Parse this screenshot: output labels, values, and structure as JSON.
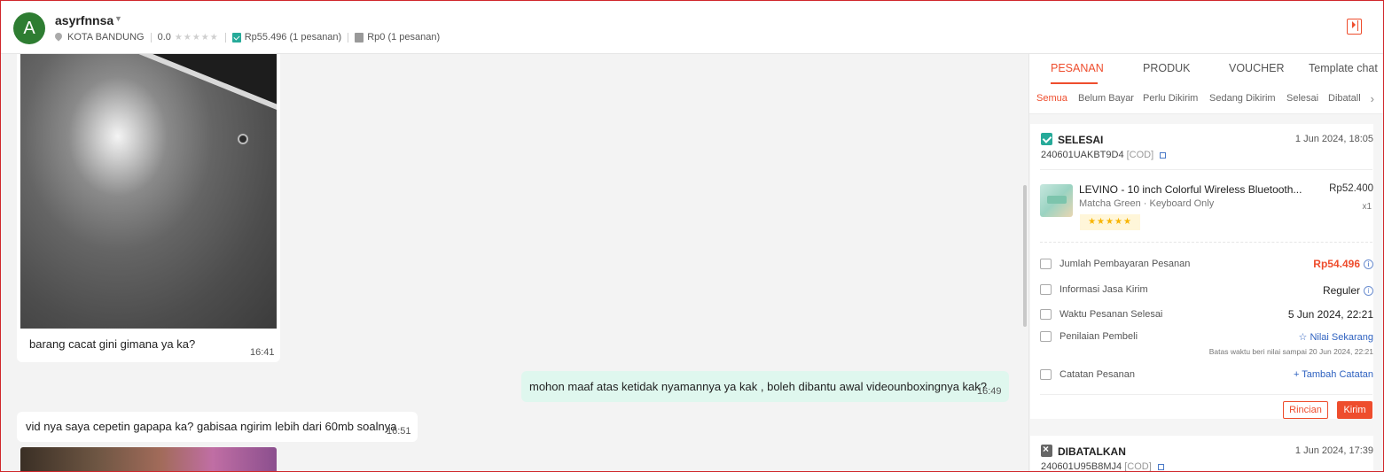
{
  "header": {
    "avatar_letter": "A",
    "username": "asyrfnnsa",
    "location": "KOTA BANDUNG",
    "rating_value": "0.0",
    "rating_stars": "★★★★★",
    "paid_total": "Rp55.496",
    "paid_count": "(1 pesanan)",
    "unpaid_total": "Rp0",
    "unpaid_count": "(1 pesanan)",
    "accent_color": "#ee4d2d"
  },
  "chat": {
    "messages": [
      {
        "direction": "in",
        "type": "image+text",
        "text": "barang cacat gini gimana ya ka?",
        "time": "16:41"
      },
      {
        "direction": "out",
        "type": "text",
        "text": "mohon maaf atas ketidak nyamannya ya kak , boleh dibantu awal  videounboxingnya kak?",
        "time": "16:49"
      },
      {
        "direction": "in",
        "type": "text",
        "text": "vid nya saya cepetin gapapa ka? gabisaa ngirim lebih dari 60mb soalnya",
        "time": "16:51"
      }
    ]
  },
  "panel": {
    "tabs": [
      {
        "label": "PESANAN",
        "active": true
      },
      {
        "label": "PRODUK",
        "active": false
      },
      {
        "label": "VOUCHER",
        "active": false
      },
      {
        "label": "Template chat",
        "active": false
      }
    ],
    "subtabs": [
      {
        "label": "Semua",
        "active": true
      },
      {
        "label": "Belum Bayar",
        "active": false
      },
      {
        "label": "Perlu Dikirim",
        "active": false
      },
      {
        "label": "Sedang Dikirim",
        "active": false
      },
      {
        "label": "Selesai",
        "active": false
      },
      {
        "label": "Dibatalkan",
        "active": false
      }
    ],
    "orders": [
      {
        "status": "SELESAI",
        "date": "1 Jun 2024, 18:05",
        "order_id": "240601UAKBT9D4",
        "tag": "[COD]",
        "product": {
          "name": "LEVINO - 10 inch Colorful Wireless Bluetooth...",
          "variant": "Matcha Green · Keyboard Only",
          "rating": "★★★★★",
          "price": "Rp52.400",
          "qty": "x1"
        },
        "rows": [
          {
            "label": "Jumlah Pembayaran Pesanan",
            "value": "Rp54.496",
            "icon": "wallet-icon"
          },
          {
            "label": "Informasi Jasa Kirim",
            "value": "Reguler",
            "icon": "truck-icon"
          },
          {
            "label": "Waktu Pesanan Selesai",
            "value": "5 Jun 2024, 22:21",
            "icon": "calendar-icon"
          },
          {
            "label": "Penilaian Pembeli",
            "value": "☆ Nilai Sekarang",
            "icon": "rating-icon"
          },
          {
            "label": "Catatan Pesanan",
            "value": "+ Tambah Catatan",
            "icon": "note-icon"
          }
        ],
        "rating_deadline": "Batas waktu beri nilai sampai 20 Jun 2024, 22:21",
        "btn_details": "Rincian",
        "btn_send": "Kirim"
      },
      {
        "status": "DIBATALKAN",
        "date": "1 Jun 2024, 17:39",
        "order_id": "240601U95B8MJ4",
        "tag": "[COD]"
      }
    ]
  }
}
